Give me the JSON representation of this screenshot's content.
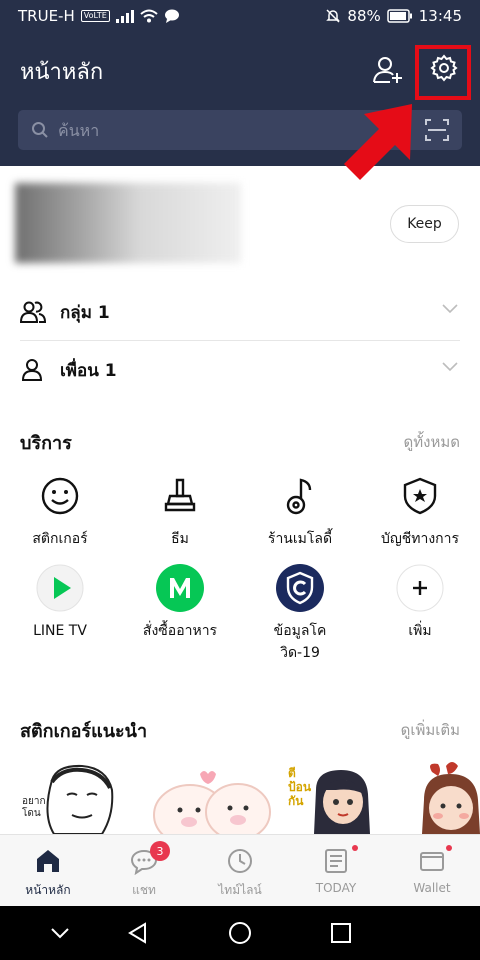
{
  "status_bar": {
    "carrier": "TRUE-H",
    "volte": "VoLTE",
    "battery": "88%",
    "time": "13:45"
  },
  "header": {
    "title": "หน้าหลัก",
    "search_placeholder": "ค้นหา"
  },
  "profile": {
    "keep_label": "Keep"
  },
  "lists": [
    {
      "label": "กลุ่ม 1"
    },
    {
      "label": "เพื่อน 1"
    }
  ],
  "services": {
    "title": "บริการ",
    "see_all": "ดูทั้งหมด",
    "items": [
      {
        "label": "สติกเกอร์",
        "icon": "smiley-icon"
      },
      {
        "label": "ธีม",
        "icon": "brush-icon"
      },
      {
        "label": "ร้านเมโลดี้",
        "icon": "music-note-icon"
      },
      {
        "label": "บัญชีทางการ",
        "icon": "official-shield-icon"
      },
      {
        "label": "LINE TV",
        "icon": "line-tv-icon"
      },
      {
        "label": "สั่งซื้ออาหาร",
        "icon": "line-man-icon"
      },
      {
        "label": "ข้อมูลโควิด-19",
        "icon": "covid-shield-icon"
      },
      {
        "label": "เพิ่ม",
        "icon": "plus-icon"
      }
    ]
  },
  "stickers": {
    "title": "สติกเกอร์แนะนำ",
    "see_more": "ดูเพิ่มเติม",
    "sticker1_text": "อยาก\nโดน",
    "sticker3_text": "ตี\nป้อน\nกัน"
  },
  "tabs": [
    {
      "label": "หน้าหลัก",
      "icon": "home-icon",
      "active": true
    },
    {
      "label": "แชท",
      "icon": "chat-icon",
      "badge": "3"
    },
    {
      "label": "ไทม์ไลน์",
      "icon": "clock-icon"
    },
    {
      "label": "TODAY",
      "icon": "news-icon"
    },
    {
      "label": "Wallet",
      "icon": "wallet-icon"
    }
  ],
  "colors": {
    "header_bg": "#273049",
    "highlight": "#e50c17",
    "badge": "#e8384f",
    "line_green": "#06c755"
  }
}
